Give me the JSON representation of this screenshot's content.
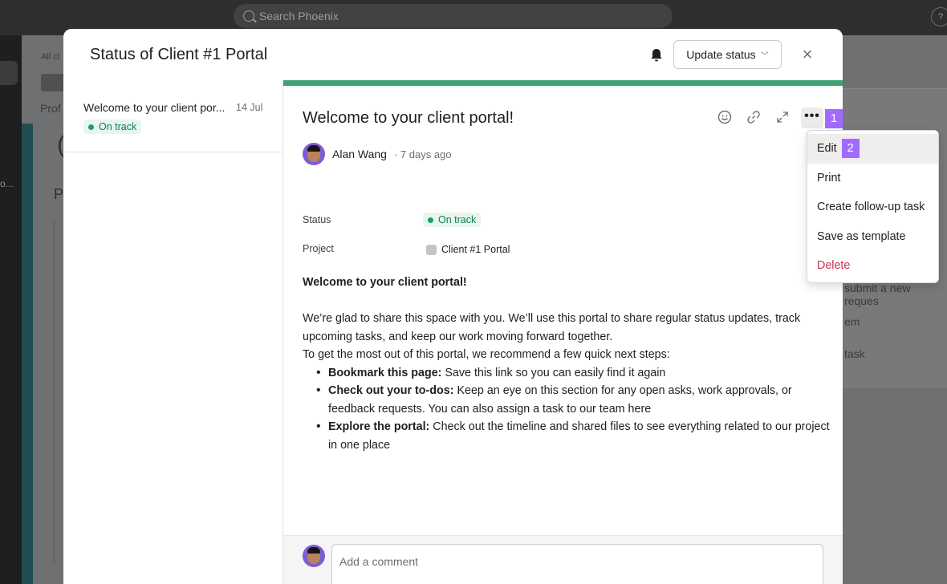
{
  "topbar": {
    "search_placeholder": "Search Phoenix",
    "help_label": "?"
  },
  "background": {
    "sidebar_ellipsis": "o...",
    "breadcrumb": "All cl",
    "tab_label": "Prof",
    "heading_fragment": "(",
    "section_fragment": "P",
    "right_items": [
      "submit a new reques",
      "em",
      "task"
    ]
  },
  "modal": {
    "title": "Status of Client #1 Portal",
    "update_status_label": "Update status",
    "close_icon": "×"
  },
  "status_list": [
    {
      "title": "Welcome to your client por...",
      "date": "14 Jul",
      "status": "On track"
    }
  ],
  "post": {
    "title": "Welcome to your client portal!",
    "author": "Alan Wang",
    "time": "· 7 days ago",
    "status_label": "Status",
    "status_value": "On track",
    "project_label": "Project",
    "project_value": "Client #1 Portal",
    "body_heading": "Welcome to your client portal!",
    "paragraph_1": "We’re glad to share this space with you. We’ll use this portal to share regular status updates, track upcoming tasks, and keep our work moving forward together.",
    "paragraph_2": "To get the most out of this portal, we recommend a few quick next steps:",
    "bullets": [
      {
        "bold": "Bookmark this page:",
        "text": " Save this link so you can easily find it again"
      },
      {
        "bold": "Check out your to-dos:",
        "text": " Keep an eye on this section for any open asks, work approvals, or feedback requests. You can also assign a task to our team here"
      },
      {
        "bold": "Explore the portal:",
        "text": " Check out the timeline and shared files to see everything related to our project in one place"
      }
    ],
    "more_label": "•••"
  },
  "comment": {
    "placeholder": "Add a comment"
  },
  "menu": {
    "items": [
      "Edit",
      "Print",
      "Create follow-up task",
      "Save as template",
      "Delete"
    ]
  },
  "annotations": {
    "more_tag": "1",
    "edit_tag": "2"
  },
  "colors": {
    "accent": "#3fa373",
    "on_track": "#1aa160",
    "danger": "#c92f54",
    "tag": "#a16bff"
  }
}
